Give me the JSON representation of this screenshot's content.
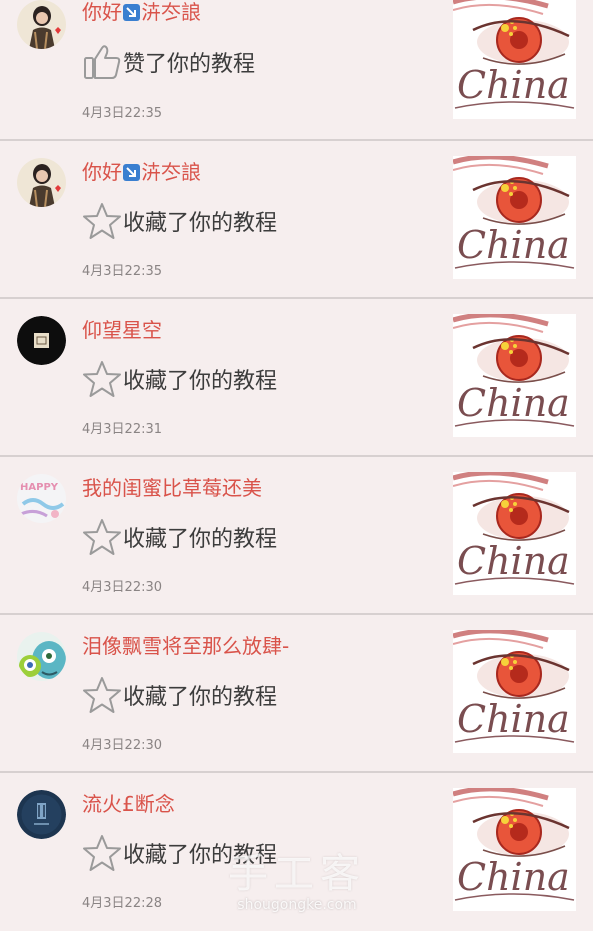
{
  "feed": {
    "items": [
      {
        "user": "你好↘泋冭誏",
        "user_parts": [
          "你好",
          "泋冭誏"
        ],
        "action_icon": "thumbs-up-icon",
        "action": "赞了你的教程",
        "time": "4月3日22:35",
        "avatar_icon": "avatar-girl-icon",
        "thumb_text": "China"
      },
      {
        "user": "你好↘泋冭誏",
        "user_parts": [
          "你好",
          "泋冭誏"
        ],
        "action_icon": "star-icon",
        "action": "收藏了你的教程",
        "time": "4月3日22:35",
        "avatar_icon": "avatar-girl-icon",
        "thumb_text": "China"
      },
      {
        "user": "仰望星空",
        "action_icon": "star-icon",
        "action": "收藏了你的教程",
        "time": "4月3日22:31",
        "avatar_icon": "avatar-black-circle-icon",
        "thumb_text": "China"
      },
      {
        "user": "我的闺蜜比草莓还美",
        "action_icon": "star-icon",
        "action": "收藏了你的教程",
        "time": "4月3日22:30",
        "avatar_icon": "avatar-happy-icon",
        "avatar_text": "HAPPY",
        "thumb_text": "China"
      },
      {
        "user": "泪像飘雪将至那么放肆-",
        "action_icon": "star-icon",
        "action": "收藏了你的教程",
        "time": "4月3日22:30",
        "avatar_icon": "avatar-monster-icon",
        "thumb_text": "China"
      },
      {
        "user": "流火£断念",
        "action_icon": "star-icon",
        "action": "收藏了你的教程",
        "time": "4月3日22:28",
        "avatar_icon": "avatar-navy-circle-icon",
        "thumb_text": "China"
      }
    ]
  },
  "watermark": {
    "logo": "手工客",
    "url": "shougongke.com"
  },
  "colors": {
    "background": "#f6eeee",
    "username": "#d9534a",
    "action_text": "#3c3c3c",
    "timestamp": "#8a8484",
    "divider": "#d7d0d0",
    "badge": "#3a7fd0"
  }
}
